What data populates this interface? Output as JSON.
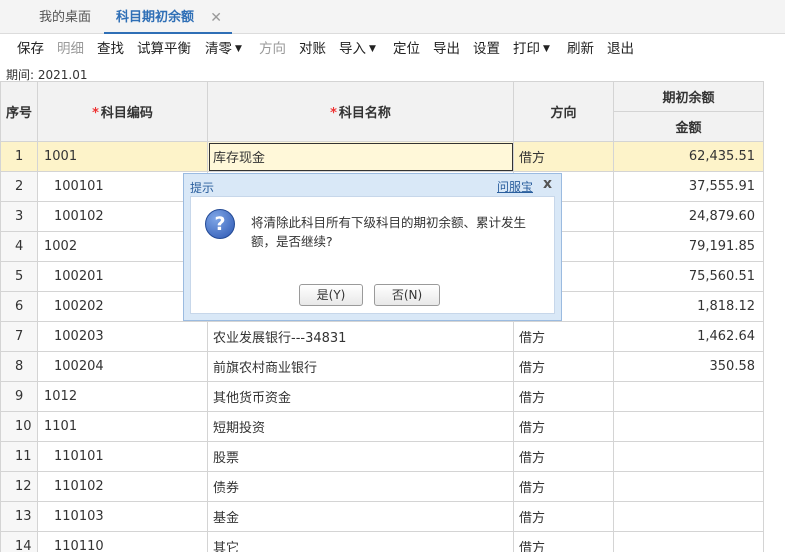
{
  "tabs": [
    {
      "label": "我的桌面"
    },
    {
      "label": "科目期初余额"
    }
  ],
  "tab_close_glyph": "✕",
  "toolbar": {
    "save": "保存",
    "detail": "明细",
    "find": "查找",
    "trial_balance": "试算平衡",
    "clear": "清零",
    "direction": "方向",
    "reconcile": "对账",
    "import": "导入",
    "locate": "定位",
    "export": "导出",
    "settings": "设置",
    "print": "打印",
    "refresh": "刷新",
    "exit": "退出"
  },
  "period": "期间: 2021.01",
  "table": {
    "headers": {
      "seq": "序号",
      "code": "科目编码",
      "name": "科目名称",
      "direction": "方向",
      "opening": "期初余额",
      "amount": "金额"
    },
    "rows": [
      {
        "seq": "1",
        "code": "1001",
        "name": "库存现金",
        "dir": "借方",
        "amount": "62,435.51"
      },
      {
        "seq": "2",
        "code": "100101",
        "name": "",
        "dir": "",
        "amount": "37,555.91"
      },
      {
        "seq": "3",
        "code": "100102",
        "name": "",
        "dir": "",
        "amount": "24,879.60"
      },
      {
        "seq": "4",
        "code": "1002",
        "name": "",
        "dir": "",
        "amount": "79,191.85"
      },
      {
        "seq": "5",
        "code": "100201",
        "name": "",
        "dir": "",
        "amount": "75,560.51"
      },
      {
        "seq": "6",
        "code": "100202",
        "name": "",
        "dir": "",
        "amount": "1,818.12"
      },
      {
        "seq": "7",
        "code": "100203",
        "name": "农业发展银行---34831",
        "dir": "借方",
        "amount": "1,462.64"
      },
      {
        "seq": "8",
        "code": "100204",
        "name": "前旗农村商业银行",
        "dir": "借方",
        "amount": "350.58"
      },
      {
        "seq": "9",
        "code": "1012",
        "name": "其他货币资金",
        "dir": "借方",
        "amount": ""
      },
      {
        "seq": "10",
        "code": "1101",
        "name": "短期投资",
        "dir": "借方",
        "amount": ""
      },
      {
        "seq": "11",
        "code": "110101",
        "name": "股票",
        "dir": "借方",
        "amount": ""
      },
      {
        "seq": "12",
        "code": "110102",
        "name": "债券",
        "dir": "借方",
        "amount": ""
      },
      {
        "seq": "13",
        "code": "110103",
        "name": "基金",
        "dir": "借方",
        "amount": ""
      },
      {
        "seq": "14",
        "code": "110110",
        "name": "其它",
        "dir": "借方",
        "amount": ""
      }
    ]
  },
  "dialog": {
    "title": "提示",
    "help_link": "问服宝",
    "close_glyph": "x",
    "icon_glyph": "?",
    "message": "将清除此科目所有下级科目的期初余额、累计发生额，是否继续?",
    "yes": "是(Y)",
    "no": "否(N)"
  },
  "colors": {
    "accent": "#2f6fb6",
    "selected_row": "#fdf3c9",
    "required": "#e33333",
    "dialog_frame": "#d9e8f7"
  }
}
